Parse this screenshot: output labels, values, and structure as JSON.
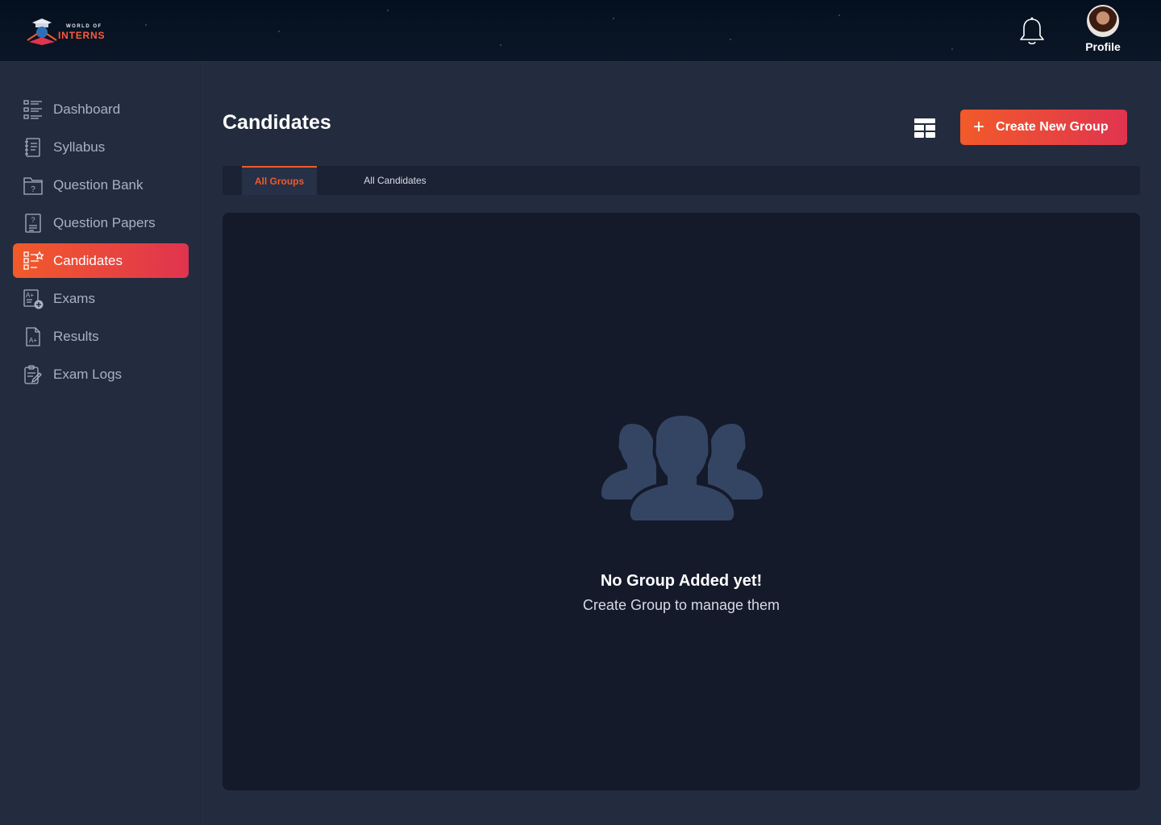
{
  "header": {
    "logo_small": "WORLD OF",
    "logo_big": "INTERNS",
    "notification_icon": "bell-icon",
    "profile_label": "Profile"
  },
  "sidebar": {
    "items": [
      {
        "label": "Dashboard",
        "icon": "dashboard-icon"
      },
      {
        "label": "Syllabus",
        "icon": "syllabus-icon"
      },
      {
        "label": "Question Bank",
        "icon": "question-bank-icon"
      },
      {
        "label": "Question Papers",
        "icon": "question-papers-icon"
      },
      {
        "label": "Candidates",
        "icon": "candidates-icon",
        "active": true
      },
      {
        "label": "Exams",
        "icon": "exams-icon"
      },
      {
        "label": "Results",
        "icon": "results-icon"
      },
      {
        "label": "Exam Logs",
        "icon": "exam-logs-icon"
      }
    ]
  },
  "main": {
    "title": "Candidates",
    "view_toggle_icon": "table-grid-icon",
    "create_button": "Create New Group",
    "tabs": [
      {
        "label": "All Groups",
        "active": true
      },
      {
        "label": "All Candidates",
        "active": false
      }
    ],
    "empty_state": {
      "icon": "people-group-icon",
      "title": "No Group Added yet!",
      "subtitle": "Create Group to manage them"
    }
  },
  "colors": {
    "accent_start": "#f25a2a",
    "accent_end": "#e0344f",
    "sidebar_bg": "#232b3e",
    "panel_bg": "#141a2a",
    "topbar_bg": "#05101f"
  }
}
